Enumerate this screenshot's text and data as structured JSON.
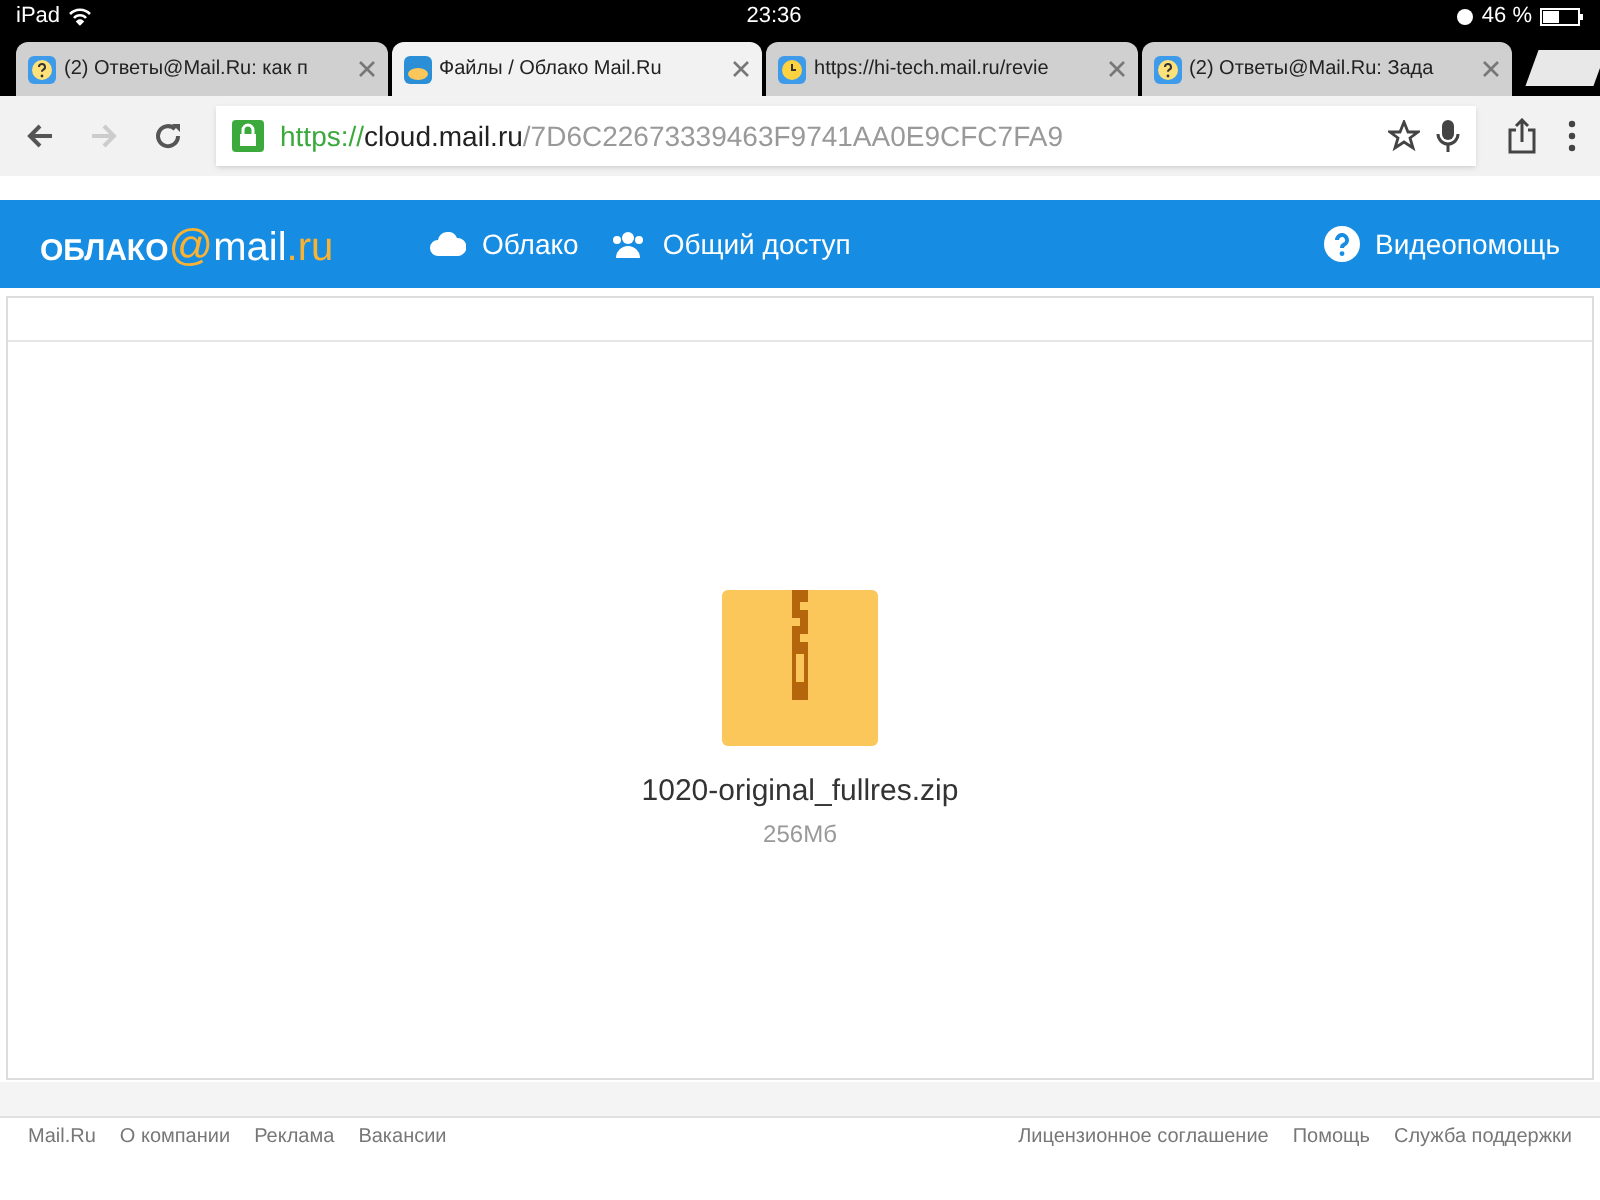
{
  "status_bar": {
    "device": "iPad",
    "time": "23:36",
    "battery": "46 %"
  },
  "tabs": [
    {
      "label": "(2) Ответы@Mail.Ru: как п",
      "selected": false
    },
    {
      "label": "Файлы / Облако Mail.Ru",
      "selected": true
    },
    {
      "label": "https://hi-tech.mail.ru/revie",
      "selected": false
    },
    {
      "label": "(2) Ответы@Mail.Ru: Зада",
      "selected": false
    }
  ],
  "address_bar": {
    "scheme": "https://",
    "host": "cloud.mail.ru",
    "path": "/7D6C22673339463F9741AA0E9CFC7FA9"
  },
  "header": {
    "logo": {
      "word": "ОБЛАКО",
      "at": "@",
      "brand": "mail",
      "tld": ".ru"
    },
    "nav": [
      {
        "label": "Облако"
      },
      {
        "label": "Общий доступ"
      }
    ],
    "help": "Видеопомощь"
  },
  "file": {
    "name": "1020-original_fullres.zip",
    "size": "256Мб"
  },
  "footer": {
    "left": [
      "Mail.Ru",
      "О компании",
      "Реклама",
      "Вакансии"
    ],
    "right": [
      "Лицензионное соглашение",
      "Помощь",
      "Служба поддержки"
    ]
  }
}
